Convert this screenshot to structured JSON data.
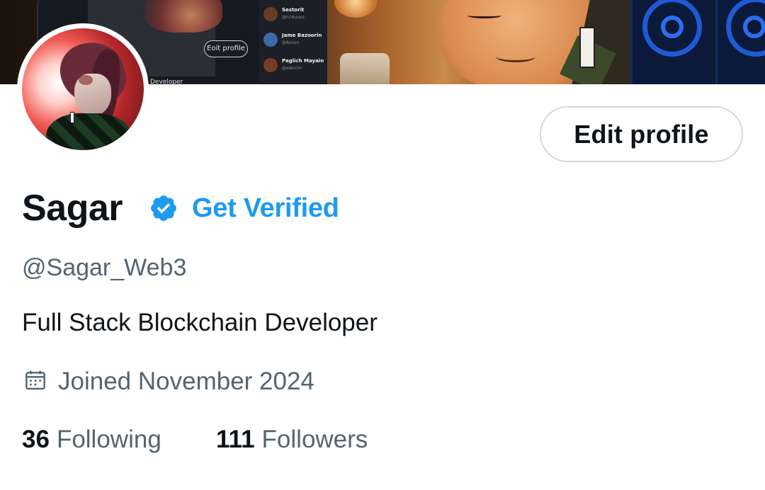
{
  "banner": {
    "edit_label": "Eoit profile",
    "dev_label": "Developer",
    "suggestions": [
      {
        "name": "Sestorit",
        "handle": "@n16uuos"
      },
      {
        "name": "Jame Bazoorin",
        "handle": "@8onsn"
      },
      {
        "name": "Paglich Mayain",
        "handle": "@elenchr"
      }
    ]
  },
  "profile": {
    "edit_button": "Edit profile",
    "name": "Sagar",
    "get_verified": "Get Verified",
    "handle": "@Sagar_Web3",
    "bio": "Full Stack Blockchain Developer",
    "joined": "Joined November 2024"
  },
  "stats": {
    "following_count": "36",
    "following_label": "Following",
    "followers_count": "111",
    "followers_label": "Followers"
  },
  "colors": {
    "accent": "#1d9bf0",
    "text_primary": "#0f1419",
    "text_secondary": "#536471",
    "border": "#cfd9de"
  },
  "icons": {
    "verified": "verified-badge-icon",
    "calendar": "calendar-icon"
  }
}
